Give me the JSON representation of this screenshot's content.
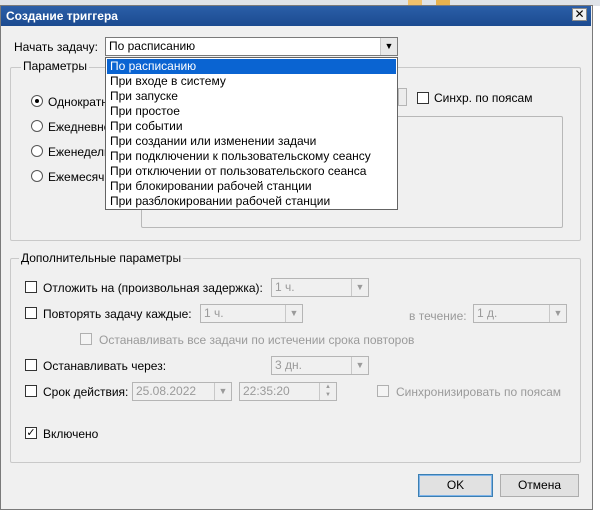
{
  "dialog": {
    "title": "Создание триггера",
    "close_glyph": "✕"
  },
  "start_task": {
    "label": "Начать задачу:",
    "value": "По расписанию",
    "options": [
      "По расписанию",
      "При входе в систему",
      "При запуске",
      "При простое",
      "При событии",
      "При создании или изменении задачи",
      "При подключении к пользовательскому сеансу",
      "При отключении от пользовательского сеанса",
      "При блокировании рабочей станции",
      "При разблокировании рабочей станции"
    ]
  },
  "params": {
    "title": "Параметры",
    "radios": [
      {
        "label": "Однократно",
        "checked": true
      },
      {
        "label": "Ежедневно",
        "checked": false
      },
      {
        "label": "Еженедельно",
        "checked": false
      },
      {
        "label": "Ежемесячно",
        "checked": false
      }
    ],
    "sync_label": "Синхр. по поясам"
  },
  "advanced": {
    "title": "Дополнительные параметры",
    "delay": {
      "label": "Отложить на (произвольная задержка):",
      "value": "1 ч."
    },
    "repeat": {
      "label": "Повторять задачу каждые:",
      "value": "1 ч.",
      "during_label": "в течение:",
      "during_value": "1 д."
    },
    "stop_all_label": "Останавливать все задачи по истечении срока повторов",
    "stop_after": {
      "label": "Останавливать через:",
      "value": "3 дн."
    },
    "expire": {
      "label": "Срок действия:",
      "date": "25.08.2022",
      "time": "22:35:20",
      "sync_label": "Синхронизировать по поясам"
    },
    "enabled": {
      "label": "Включено",
      "checked": true
    }
  },
  "buttons": {
    "ok": "OK",
    "cancel": "Отмена"
  }
}
